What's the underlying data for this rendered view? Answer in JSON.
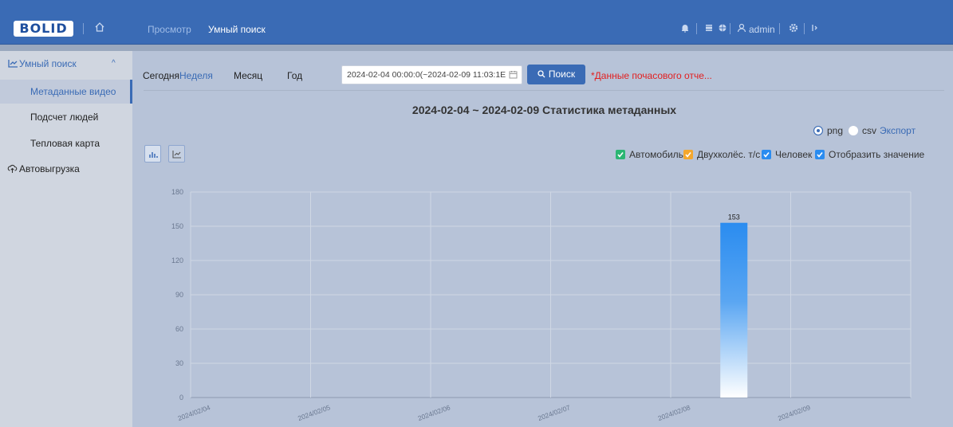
{
  "header": {
    "logo": "BOLID",
    "nav": [
      "Просмотр",
      "Умный поиск"
    ],
    "user": "admin"
  },
  "sidebar": {
    "group": "Умный поиск",
    "items": [
      "Метаданные видео",
      "Подсчет людей",
      "Тепловая карта"
    ],
    "upload": "Автовыгрузка"
  },
  "filters": {
    "today": "Сегодня",
    "week": "Неделя",
    "month": "Месяц",
    "year": "Год",
    "date_range": "2024-02-04 00:00:0(~2024-02-09 11:03:1E",
    "search": "Поиск",
    "warning": "*Данные почасового отче..."
  },
  "export": {
    "formats": [
      "png",
      "csv"
    ],
    "selected": "png",
    "label": "Экспорт"
  },
  "legend": [
    {
      "label": "Автомобиль",
      "color": "#2bb673"
    },
    {
      "label": "Двухколёс. т/с",
      "color": "#f4a72d"
    },
    {
      "label": "Человек",
      "color": "#2a8cf0"
    },
    {
      "label": "Отобразить значение",
      "color": "#2a8cf0"
    }
  ],
  "chart_data": {
    "type": "bar",
    "title": "2024-02-04 ~ 2024-02-09 Статистика метаданных",
    "categories": [
      "2024/02/04",
      "2024/02/05",
      "2024/02/06",
      "2024/02/07",
      "2024/02/08",
      "2024/02/09"
    ],
    "series": [
      {
        "name": "Человек",
        "values": [
          0,
          0,
          0,
          0,
          153,
          0
        ],
        "color": "#2a8cf0"
      }
    ],
    "ylim": [
      0,
      180
    ],
    "yticks": [
      0,
      30,
      60,
      90,
      120,
      150,
      180
    ],
    "data_labels": true,
    "grid": true
  }
}
